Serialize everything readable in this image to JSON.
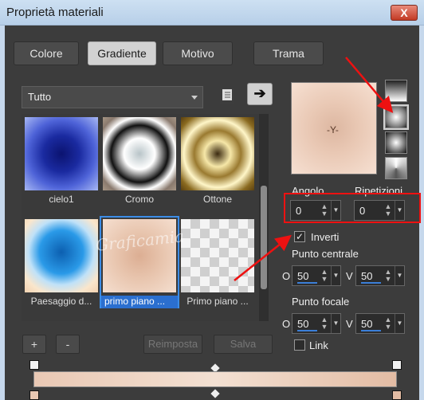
{
  "window": {
    "title": "Proprietà materiali",
    "close_label": "X"
  },
  "tabs": [
    {
      "label": "Colore",
      "active": false
    },
    {
      "label": "Gradiente",
      "active": true
    },
    {
      "label": "Motivo",
      "active": false
    },
    {
      "label": "Trama",
      "active": false
    }
  ],
  "category_select": {
    "value": "Tutto"
  },
  "gallery": {
    "items": [
      {
        "label": "cielo1",
        "selected": false
      },
      {
        "label": "Cromo",
        "selected": false
      },
      {
        "label": "Ottone",
        "selected": false
      },
      {
        "label": "Paesaggio d...",
        "selected": false
      },
      {
        "label": "primo piano ...",
        "selected": true
      },
      {
        "label": "Primo piano ...",
        "selected": false
      }
    ]
  },
  "gallery_buttons": {
    "add": "+",
    "remove": "-",
    "reset": "Reimposta",
    "save": "Salva"
  },
  "controls": {
    "angle_label": "Angolo",
    "angle_value": "0",
    "repeat_label": "Ripetizioni",
    "repeat_value": "0",
    "invert_label": "Inverti",
    "invert_checked": true,
    "center_label": "Punto centrale",
    "center_h_label": "O",
    "center_h_value": "50",
    "center_v_label": "V",
    "center_v_value": "50",
    "focal_label": "Punto focale",
    "focal_h_label": "O",
    "focal_h_value": "50",
    "focal_v_label": "V",
    "focal_v_value": "50",
    "link_label": "Link",
    "link_checked": false
  },
  "watermark": {
    "text": "Graficamia"
  },
  "icons": {
    "library": "book-icon",
    "arrow": "arrow-right-icon"
  },
  "colors": {
    "accent": "#3c8ce6",
    "annotation": "#e11111"
  }
}
